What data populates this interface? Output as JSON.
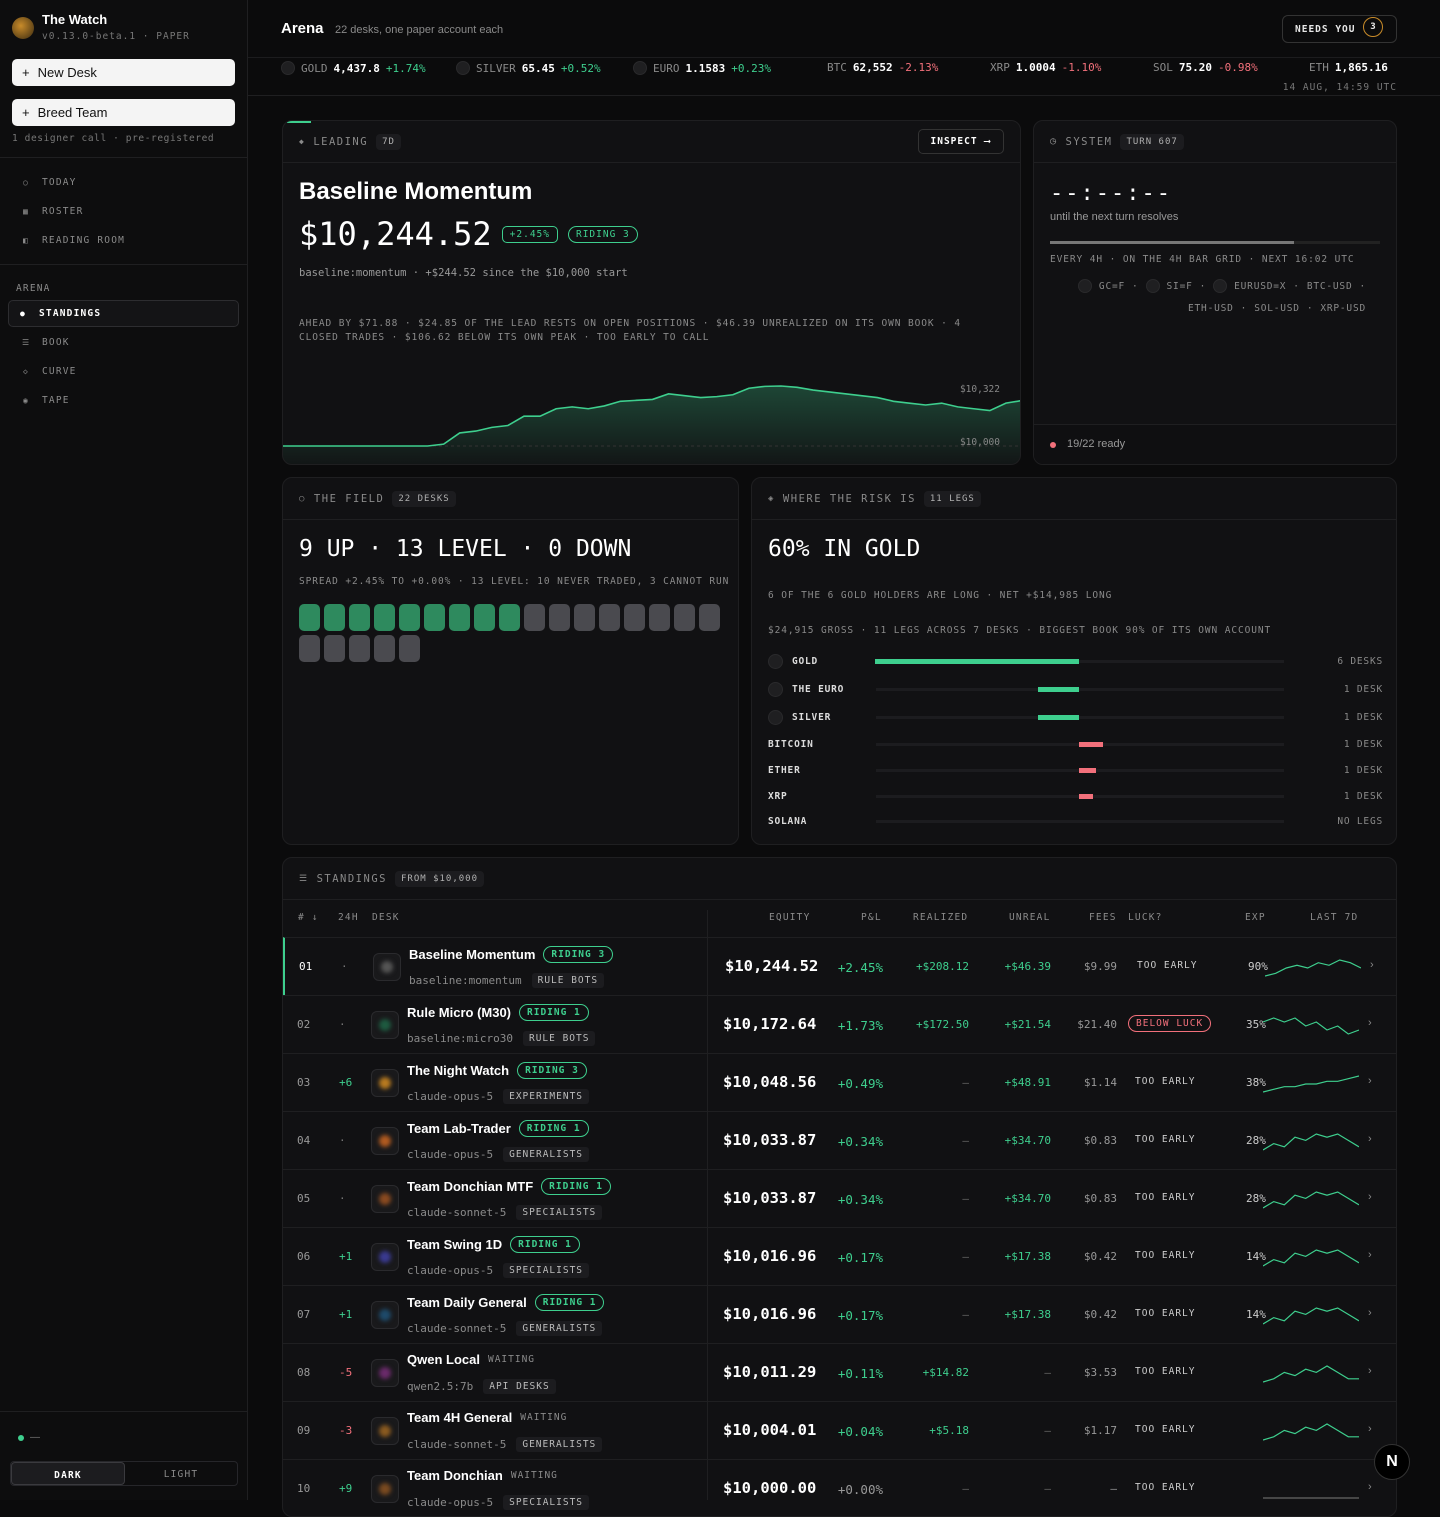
{
  "app": {
    "title": "The Watch",
    "version": "v0.13.0-beta.1",
    "mode": "PAPER"
  },
  "sidebar": {
    "new_desk": "New Desk",
    "breed_team": "Breed Team",
    "note": "1 designer call · pre-registered",
    "nav": [
      {
        "label": "TODAY",
        "icon": "circle-icon"
      },
      {
        "label": "ROSTER",
        "icon": "grid-icon"
      },
      {
        "label": "READING ROOM",
        "icon": "book-icon"
      }
    ],
    "arena_label": "ARENA",
    "arena_nav": [
      {
        "label": "STANDINGS"
      },
      {
        "label": "BOOK"
      },
      {
        "label": "CURVE"
      },
      {
        "label": "TAPE"
      }
    ],
    "status_text": "—",
    "theme": {
      "dark": "DARK",
      "light": "LIGHT"
    }
  },
  "header": {
    "title": "Arena",
    "subtitle": "22 desks, one paper account each",
    "needs_you": "NEEDS YOU",
    "needs_count": "3",
    "stamp": "14 AUG, 14:59 UTC"
  },
  "tickers": [
    {
      "sym": "GOLD",
      "px": "4,437.8",
      "chg": "+1.74%",
      "dir": "up",
      "dot": true
    },
    {
      "sym": "SILVER",
      "px": "65.45",
      "chg": "+0.52%",
      "dir": "up",
      "dot": true
    },
    {
      "sym": "EURO",
      "px": "1.1583",
      "chg": "+0.23%",
      "dir": "up",
      "dot": true
    },
    {
      "sym": "BTC",
      "px": "62,552",
      "chg": "-2.13%",
      "dir": "down",
      "dot": false
    },
    {
      "sym": "XRP",
      "px": "1.0004",
      "chg": "-1.10%",
      "dir": "down",
      "dot": false
    },
    {
      "sym": "SOL",
      "px": "75.20",
      "chg": "-0.98%",
      "dir": "down",
      "dot": false
    },
    {
      "sym": "ETH",
      "px": "1,865.16",
      "chg": "",
      "dir": "flat",
      "dot": false
    }
  ],
  "leading": {
    "label": "LEADING",
    "period": "7D",
    "inspect": "INSPECT ⟶",
    "name": "Baseline Momentum",
    "equity": "$10,244.52",
    "change": "+2.45%",
    "riding": "RIDING 3",
    "sub": "baseline:momentum · +$244.52 since the $10,000 start",
    "detail": "AHEAD BY $71.88 · $24.85 OF THE LEAD RESTS ON OPEN POSITIONS · $46.39 UNREALIZED ON ITS OWN BOOK · 4 CLOSED TRADES · $106.62 BELOW ITS OWN PEAK · TOO EARLY TO CALL",
    "hi_label": "$10,322",
    "lo_label": "$10,000",
    "curve": [
      10000,
      10000,
      10000,
      10000,
      10000,
      10000,
      10000,
      10000,
      10000,
      10000,
      10010,
      10070,
      10080,
      10100,
      10110,
      10160,
      10160,
      10200,
      10210,
      10200,
      10215,
      10240,
      10245,
      10250,
      10280,
      10270,
      10260,
      10265,
      10275,
      10310,
      10320,
      10322,
      10315,
      10300,
      10290,
      10280,
      10270,
      10260,
      10240,
      10230,
      10220,
      10230,
      10210,
      10200,
      10190,
      10230,
      10244
    ]
  },
  "system": {
    "label": "SYSTEM",
    "turn": "TURN 607",
    "countdown": "--:--:--",
    "until": "until the next turn resolves",
    "progress": 0.74,
    "line1": "EVERY 4H · ON THE 4H BAR GRID · NEXT 16:02 UTC",
    "instr1": [
      "GC=F",
      "SI=F",
      "EURUSD=X",
      "BTC-USD"
    ],
    "instr2": [
      "ETH-USD",
      "SOL-USD",
      "XRP-USD"
    ],
    "ready": "19/22 ready"
  },
  "field": {
    "label": "THE FIELD",
    "chip": "22 DESKS",
    "headline": "9 UP · 13 LEVEL · 0 DOWN",
    "sub": "SPREAD +2.45% TO +0.00% · 13 LEVEL: 10 NEVER TRADED, 3 CANNOT RUN",
    "up": 9,
    "level": 13,
    "down": 0
  },
  "risk": {
    "label": "WHERE THE RISK IS",
    "chip": "11 LEGS",
    "headline": "60% IN GOLD",
    "sub1": "6 OF THE 6 GOLD HOLDERS ARE LONG · NET +$14,985 LONG",
    "sub2": "$24,915 GROSS · 11 LEGS ACROSS 7 DESKS · BIGGEST BOOK 90% OF ITS OWN ACCOUNT",
    "rows": [
      {
        "name": "GOLD",
        "value": 0.6,
        "side": "long",
        "desks": "6 DESKS",
        "dot": true
      },
      {
        "name": "THE EURO",
        "value": 0.12,
        "side": "long",
        "desks": "1 DESK",
        "dot": true
      },
      {
        "name": "SILVER",
        "value": 0.12,
        "side": "long",
        "desks": "1 DESK",
        "dot": true
      },
      {
        "name": "BITCOIN",
        "value": 0.07,
        "side": "short",
        "desks": "1 DESK",
        "dot": false
      },
      {
        "name": "ETHER",
        "value": 0.05,
        "side": "short",
        "desks": "1 DESK",
        "dot": false
      },
      {
        "name": "XRP",
        "value": 0.04,
        "side": "short",
        "desks": "1 DESK",
        "dot": false
      },
      {
        "name": "SOLANA",
        "value": 0,
        "side": "none",
        "desks": "NO LEGS",
        "dot": false
      }
    ]
  },
  "standings": {
    "label": "STANDINGS",
    "chip": "FROM $10,000",
    "headers": {
      "rank": "# ↓",
      "d24": "24H",
      "desk": "DESK",
      "equity": "EQUITY",
      "pnl": "P&L",
      "realized": "REALIZED",
      "unreal": "UNREAL",
      "fees": "FEES",
      "luck": "LUCK?",
      "exp": "EXP",
      "last7": "LAST 7D"
    },
    "rows": [
      {
        "rank": "01",
        "d24": "·",
        "name": "Baseline Momentum",
        "status": "RIDING 3",
        "riding": true,
        "sub": "baseline:momentum",
        "tag": "RULE BOTS",
        "equity": "$10,244.52",
        "pnl": "+2.45%",
        "realized": "+$208.12",
        "unreal": "+$46.39",
        "fees": "$9.99",
        "luck": "TOO EARLY",
        "exp": "90%",
        "color": "#555",
        "spark": [
          3,
          4,
          6,
          7,
          6,
          8,
          7,
          9,
          8,
          6
        ]
      },
      {
        "rank": "02",
        "d24": "·",
        "name": "Rule Micro (M30)",
        "status": "RIDING 1",
        "riding": true,
        "sub": "baseline:micro30",
        "tag": "RULE BOTS",
        "equity": "$10,172.64",
        "pnl": "+1.73%",
        "realized": "+$172.50",
        "unreal": "+$21.54",
        "fees": "$21.40",
        "luck": "BELOW LUCK",
        "exp": "35%",
        "color": "#1e5a40",
        "spark": [
          7,
          8,
          7,
          8,
          6,
          7,
          5,
          6,
          4,
          5
        ]
      },
      {
        "rank": "03",
        "d24": "+6",
        "name": "The Night Watch",
        "status": "RIDING 3",
        "riding": true,
        "sub": "claude-opus-5",
        "tag": "EXPERIMENTS",
        "equity": "$10,048.56",
        "pnl": "+0.49%",
        "realized": "–",
        "unreal": "+$48.91",
        "fees": "$1.14",
        "luck": "TOO EARLY",
        "exp": "38%",
        "color": "#b77a20",
        "spark": [
          3,
          4,
          5,
          5,
          6,
          6,
          7,
          7,
          8,
          9
        ]
      },
      {
        "rank": "04",
        "d24": "·",
        "name": "Team Lab-Trader",
        "status": "RIDING 1",
        "riding": true,
        "sub": "claude-opus-5",
        "tag": "GENERALISTS",
        "equity": "$10,033.87",
        "pnl": "+0.34%",
        "realized": "–",
        "unreal": "+$34.70",
        "fees": "$0.83",
        "luck": "TOO EARLY",
        "exp": "28%",
        "color": "#b05a20",
        "spark": [
          3,
          5,
          4,
          7,
          6,
          8,
          7,
          8,
          6,
          4
        ]
      },
      {
        "rank": "05",
        "d24": "·",
        "name": "Team Donchian MTF",
        "status": "RIDING 1",
        "riding": true,
        "sub": "claude-sonnet-5",
        "tag": "SPECIALISTS",
        "equity": "$10,033.87",
        "pnl": "+0.34%",
        "realized": "–",
        "unreal": "+$34.70",
        "fees": "$0.83",
        "luck": "TOO EARLY",
        "exp": "28%",
        "color": "#8a4a20",
        "spark": [
          3,
          5,
          4,
          7,
          6,
          8,
          7,
          8,
          6,
          4
        ]
      },
      {
        "rank": "06",
        "d24": "+1",
        "name": "Team Swing 1D",
        "status": "RIDING 1",
        "riding": true,
        "sub": "claude-opus-5",
        "tag": "SPECIALISTS",
        "equity": "$10,016.96",
        "pnl": "+0.17%",
        "realized": "–",
        "unreal": "+$17.38",
        "fees": "$0.42",
        "luck": "TOO EARLY",
        "exp": "14%",
        "color": "#3a3a90",
        "spark": [
          3,
          5,
          4,
          7,
          6,
          8,
          7,
          8,
          6,
          4
        ]
      },
      {
        "rank": "07",
        "d24": "+1",
        "name": "Team Daily General",
        "status": "RIDING 1",
        "riding": true,
        "sub": "claude-sonnet-5",
        "tag": "GENERALISTS",
        "equity": "$10,016.96",
        "pnl": "+0.17%",
        "realized": "–",
        "unreal": "+$17.38",
        "fees": "$0.42",
        "luck": "TOO EARLY",
        "exp": "14%",
        "color": "#1e4a6a",
        "spark": [
          3,
          5,
          4,
          7,
          6,
          8,
          7,
          8,
          6,
          4
        ]
      },
      {
        "rank": "08",
        "d24": "-5",
        "name": "Qwen Local",
        "status": "WAITING",
        "riding": false,
        "sub": "qwen2.5:7b",
        "tag": "API DESKS",
        "equity": "$10,011.29",
        "pnl": "+0.11%",
        "realized": "+$14.82",
        "unreal": "–",
        "fees": "$3.53",
        "luck": "TOO EARLY",
        "exp": "–",
        "color": "#6a2a6a",
        "spark": [
          3,
          4,
          6,
          5,
          7,
          6,
          8,
          6,
          4,
          4
        ]
      },
      {
        "rank": "09",
        "d24": "-3",
        "name": "Team 4H General",
        "status": "WAITING",
        "riding": false,
        "sub": "claude-sonnet-5",
        "tag": "GENERALISTS",
        "equity": "$10,004.01",
        "pnl": "+0.04%",
        "realized": "+$5.18",
        "unreal": "–",
        "fees": "$1.17",
        "luck": "TOO EARLY",
        "exp": "–",
        "color": "#8a5a20",
        "spark": [
          3,
          4,
          6,
          5,
          7,
          6,
          8,
          6,
          4,
          4
        ]
      },
      {
        "rank": "10",
        "d24": "+9",
        "name": "Team Donchian",
        "status": "WAITING",
        "riding": false,
        "sub": "claude-opus-5",
        "tag": "SPECIALISTS",
        "equity": "$10,000.00",
        "pnl": "+0.00%",
        "realized": "–",
        "unreal": "–",
        "fees": "–",
        "luck": "TOO EARLY",
        "exp": "–",
        "color": "#7a4a20",
        "spark": [
          5,
          5,
          5,
          5,
          5,
          5,
          5,
          5,
          5,
          5
        ]
      }
    ]
  },
  "colors": {
    "up": "#3ecf8e",
    "down": "#f2707b",
    "level": "#4a4a4f",
    "bg": "#0b0b0c",
    "panel": "#111113"
  }
}
